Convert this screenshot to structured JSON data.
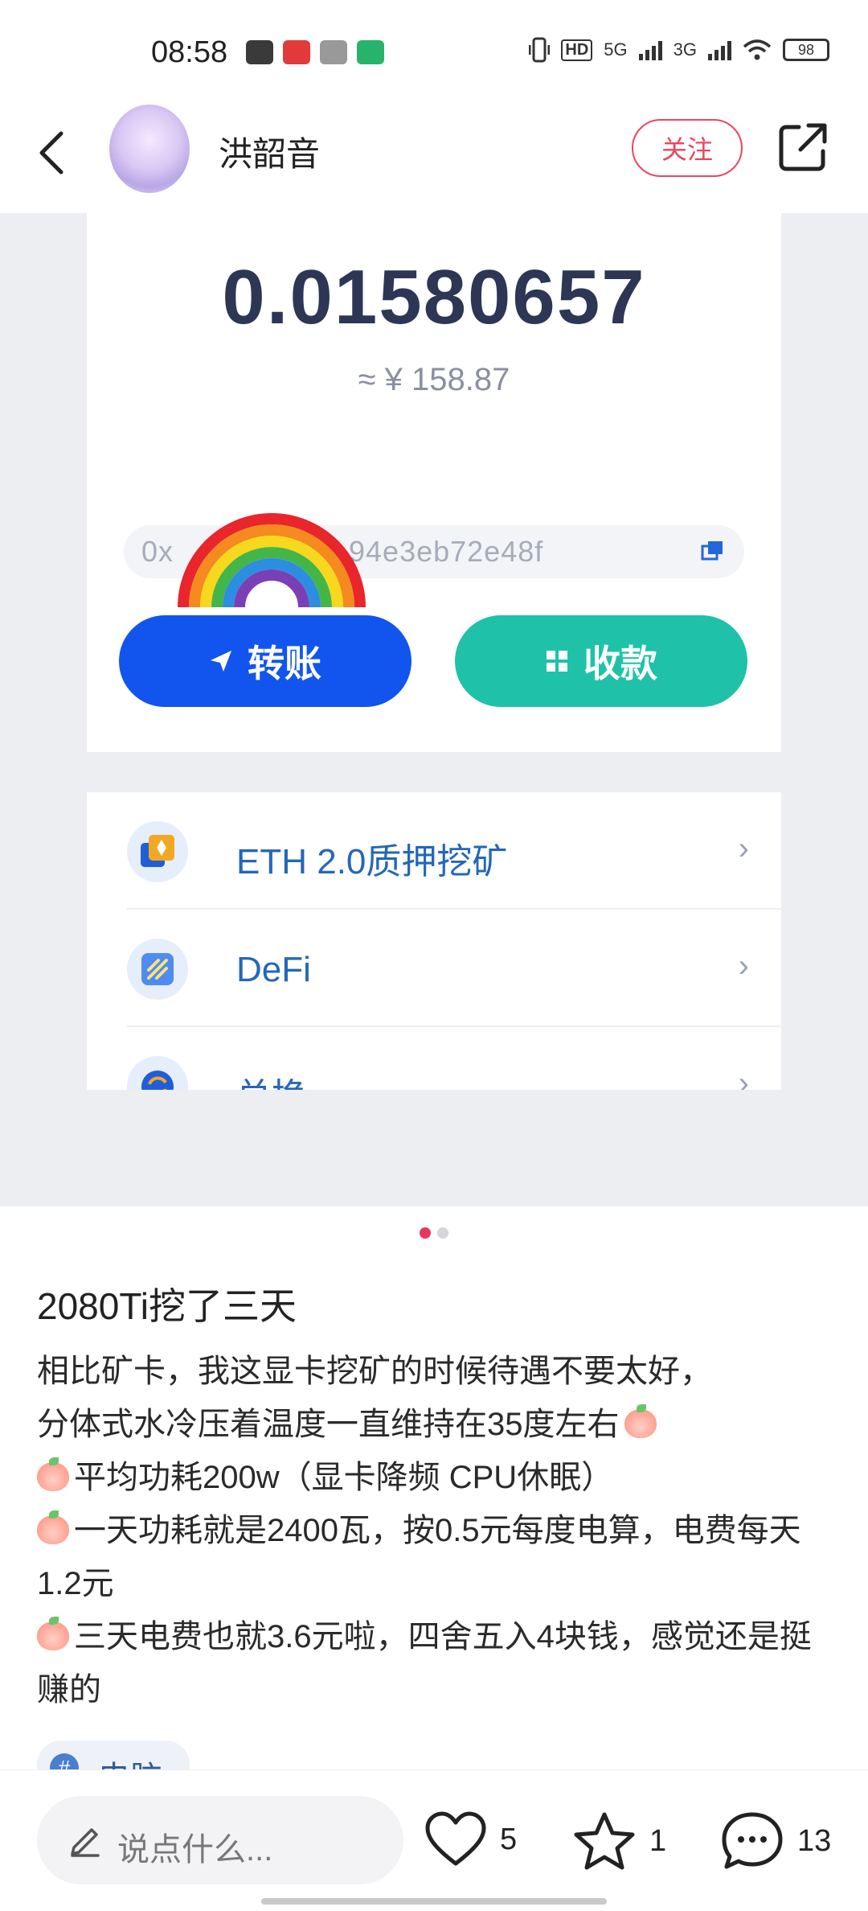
{
  "status_bar": {
    "time": "08:58",
    "network_1": "5G",
    "network_2": "3G",
    "battery": "98"
  },
  "header": {
    "author_name": "洪韶音",
    "follow_label": "关注"
  },
  "wallet": {
    "balance": "0.01580657",
    "fiat_value": "≈ ¥ 158.87",
    "address_prefix": "0x",
    "address_suffix": "94e3eb72e48f",
    "transfer_label": "转账",
    "receive_label": "收款",
    "menu": [
      {
        "label": "ETH 2.0质押挖矿"
      },
      {
        "label": "DeFi"
      },
      {
        "label": "兑换"
      }
    ]
  },
  "carousel": {
    "current": 1,
    "total": 2
  },
  "post": {
    "title": "2080Ti挖了三天",
    "line1": "相比矿卡，我这显卡挖矿的时候待遇不要太好，",
    "line2": "分体式水冷压着温度一直维持在35度左右",
    "line3": "平均功耗200w（显卡降频 CPU休眠）",
    "line4": "一天功耗就是2400瓦，按0.5元每度电算，电费每天1.2元",
    "line5": "三天电费也就3.6元啦，四舍五入4块钱，感觉还是挺赚的",
    "tag": "电脑"
  },
  "bottom_bar": {
    "comment_placeholder": "说点什么...",
    "likes": "5",
    "favorites": "1",
    "comments": "13"
  },
  "colors": {
    "accent": "#e9475e",
    "transfer_button": "#1155ee",
    "receive_button": "#1fc2a8",
    "menu_text": "#2467b8"
  }
}
